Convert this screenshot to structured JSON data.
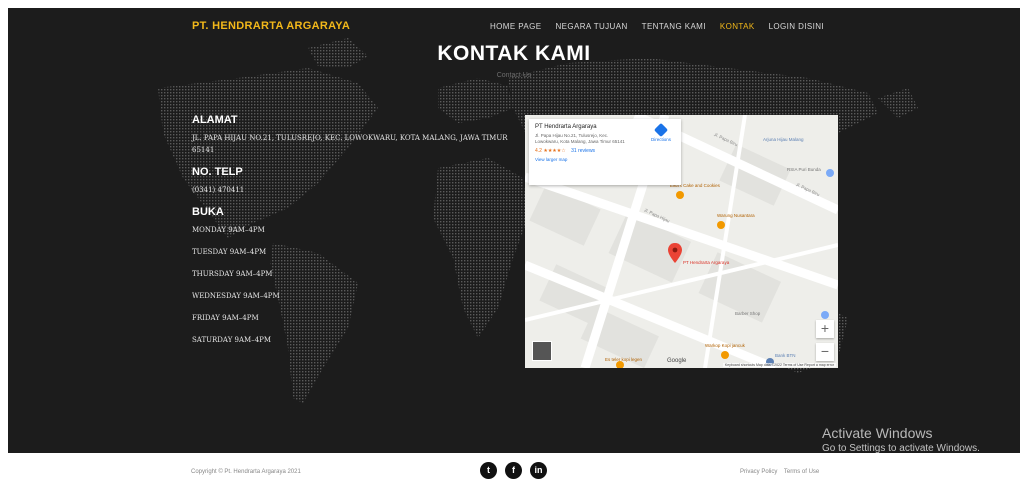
{
  "nav": {
    "brand": "PT. HENDRARTA ARGARAYA",
    "items": [
      {
        "label": "HOME PAGE",
        "active": false
      },
      {
        "label": "NEGARA TUJUAN",
        "active": false
      },
      {
        "label": "TENTANG KAMI",
        "active": false
      },
      {
        "label": "KONTAK",
        "active": true
      },
      {
        "label": "LOGIN DISINI",
        "active": false
      }
    ]
  },
  "hero": {
    "title": "KONTAK KAMI",
    "subtitle": "Contact Us"
  },
  "contact": {
    "address_heading": "ALAMAT",
    "address": "JL. PAPA HIJAU NO.21, TULUSREJO, KEC. LOWOKWARU, KOTA MALANG, JAWA TIMUR 65141",
    "phone_heading": "NO. TELP",
    "phone": "(0341) 470411",
    "hours_heading": "BUKA",
    "hours": [
      "MONDAY 9AM–4PM",
      "TUESDAY 9AM–4PM",
      "THURSDAY 9AM–4PM",
      "WEDNESDAY 9AM–4PM",
      "FRIDAY 9AM–4PM",
      "SATURDAY 9AM–4PM"
    ]
  },
  "map": {
    "place_name": "PT Hendrarta Argaraya",
    "place_address": "Jl. Papa Hijau No.21, Tulusrejo, Kec. Lowokwaru, Kota Malang, Jawa Timur 65141",
    "rating": "4.2",
    "stars": "★★★★☆",
    "reviews": "31 reviews",
    "view_larger": "View larger map",
    "directions": "Directions",
    "pin_label": "PT Hendrarta Argaraya",
    "pois": [
      {
        "label": "Arjuna Hijau Malang",
        "style": "blue"
      },
      {
        "label": "RSIA Puri Bunda",
        "style": "grey"
      },
      {
        "label": "Elka's Cake and Cookies",
        "style": "orange"
      },
      {
        "label": "Warung Nusantara",
        "style": "orange"
      },
      {
        "label": "Barber Shop",
        "style": "grey"
      },
      {
        "label": "Warkop Kopi jancuk",
        "style": "orange"
      },
      {
        "label": "Es teler kopi legen",
        "style": "orange"
      },
      {
        "label": "Bank BTN",
        "style": "blue"
      }
    ],
    "streets": [
      "Jl. Papa Biru",
      "Jl. Papa Hijau",
      "Jl. Papa Biru"
    ],
    "google": "Google",
    "legal": "Keyboard shortcuts   Map data ©2022   Terms of Use   Report a map error",
    "zoom_in": "+",
    "zoom_out": "−"
  },
  "watermark": {
    "line1": "Activate Windows",
    "line2": "Go to Settings to activate Windows."
  },
  "footer": {
    "copyright": "Copyright © Pt. Hendrarta Argaraya 2021",
    "social": [
      {
        "icon": "twitter-icon",
        "glyph": "t"
      },
      {
        "icon": "facebook-icon",
        "glyph": "f"
      },
      {
        "icon": "linkedin-icon",
        "glyph": "in"
      }
    ],
    "links": [
      "Privacy Policy",
      "Terms of Use"
    ]
  }
}
